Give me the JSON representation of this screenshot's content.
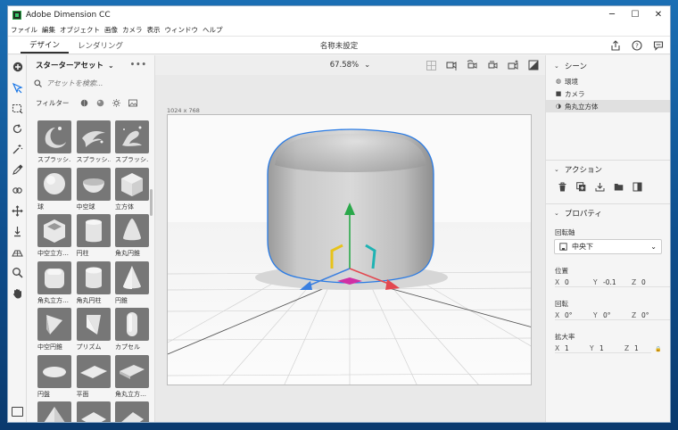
{
  "window": {
    "title": "Adobe Dimension CC",
    "controls": {
      "minimize": "─",
      "maximize": "☐",
      "close": "✕"
    }
  },
  "menu": [
    "ファイル",
    "編集",
    "オブジェクト",
    "画像",
    "カメラ",
    "表示",
    "ウィンドウ",
    "ヘルプ"
  ],
  "top": {
    "tabs": [
      "デザイン",
      "レンダリング"
    ],
    "document_title": "名称未設定"
  },
  "assets": {
    "title": "スターターアセット",
    "more": "•••",
    "search_placeholder": "アセットを検索...",
    "filter_label": "フィルター",
    "items": [
      {
        "label": "スプラッシ…",
        "shape": "splash1"
      },
      {
        "label": "スプラッシ…",
        "shape": "splash2"
      },
      {
        "label": "スプラッシ…",
        "shape": "splash3"
      },
      {
        "label": "球",
        "shape": "sphere"
      },
      {
        "label": "中空球",
        "shape": "hollow-sphere"
      },
      {
        "label": "立方体",
        "shape": "cube"
      },
      {
        "label": "中空立方…",
        "shape": "hollow-cube"
      },
      {
        "label": "円柱",
        "shape": "cylinder"
      },
      {
        "label": "角丸円錐",
        "shape": "round-cone"
      },
      {
        "label": "角丸立方…",
        "shape": "round-cube"
      },
      {
        "label": "角丸円柱",
        "shape": "round-cylinder"
      },
      {
        "label": "円錐",
        "shape": "cone"
      },
      {
        "label": "中空円錐",
        "shape": "hollow-cone"
      },
      {
        "label": "プリズム",
        "shape": "prism"
      },
      {
        "label": "カプセル",
        "shape": "capsule"
      },
      {
        "label": "円盤",
        "shape": "disc"
      },
      {
        "label": "平面",
        "shape": "plane"
      },
      {
        "label": "角丸立方…",
        "shape": "round-cube-2"
      },
      {
        "label": "",
        "shape": "pyramid"
      },
      {
        "label": "",
        "shape": "plane-2"
      },
      {
        "label": "",
        "shape": "wedge"
      }
    ]
  },
  "canvas": {
    "zoom": "67.58%",
    "doc_size": "1024 x 768"
  },
  "scene": {
    "title": "シーン",
    "items": [
      {
        "label": "環境",
        "icon": "globe-icon",
        "selected": false
      },
      {
        "label": "カメラ",
        "icon": "camera-icon",
        "selected": false
      },
      {
        "label": "角丸立方体",
        "icon": "object-icon",
        "selected": true
      }
    ]
  },
  "actions": {
    "title": "アクション"
  },
  "properties": {
    "title": "プロパティ",
    "pivot_label": "回転軸",
    "pivot_value": "中央下",
    "position_label": "位置",
    "position": {
      "x": "0",
      "y": "-0.1",
      "z": "0"
    },
    "rotation_label": "回転",
    "rotation": {
      "x": "0°",
      "y": "0°",
      "z": "0°"
    },
    "scale_label": "拡大率",
    "scale": {
      "x": "1",
      "y": "1",
      "z": "1"
    }
  },
  "colors": {
    "accent": "#1473e6",
    "gizmo_green": "#2aa84a",
    "gizmo_red": "#e34850",
    "gizmo_yellow": "#e7c31a",
    "gizmo_cyan": "#1fb3b3",
    "gizmo_magenta": "#d02fa5"
  }
}
